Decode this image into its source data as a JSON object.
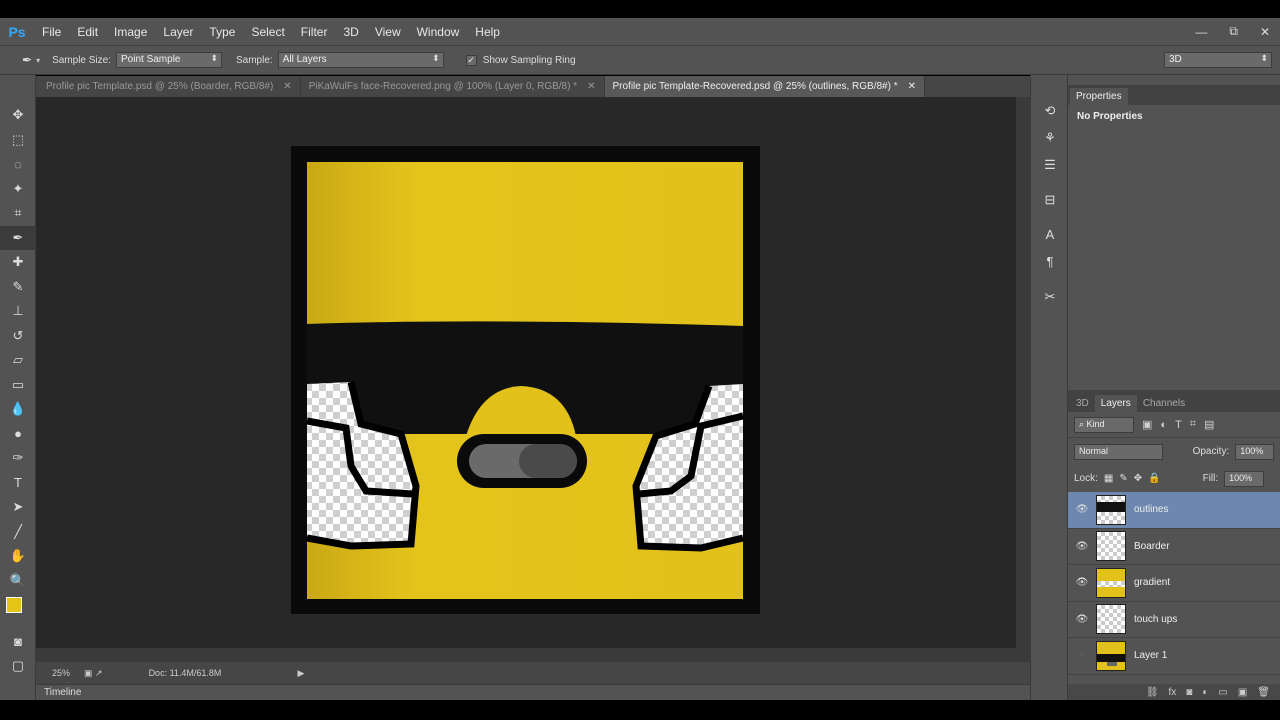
{
  "app": {
    "logo": "Ps"
  },
  "menu": [
    "File",
    "Edit",
    "Image",
    "Layer",
    "Type",
    "Select",
    "Filter",
    "3D",
    "View",
    "Window",
    "Help"
  ],
  "window_controls": {
    "minimize": "—",
    "restore": "⧉",
    "close": "✕"
  },
  "options": {
    "sample_size_label": "Sample Size:",
    "sample_size_value": "Point Sample",
    "sample_label": "Sample:",
    "sample_value": "All Layers",
    "show_ring_label": "Show Sampling Ring",
    "workspace_value": "3D"
  },
  "tabs": [
    {
      "title": "Profile pic Template.psd @ 25% (Boarder, RGB/8#)",
      "close": "✕"
    },
    {
      "title": "PiKaWulFs face-Recovered.png @ 100% (Layer 0, RGB/8) *",
      "close": "✕"
    },
    {
      "title": "Profile pic Template-Recovered.psd @ 25% (outlines, RGB/8#) *",
      "close": "✕"
    }
  ],
  "status": {
    "zoom": "25%",
    "doc_info": "Doc: 11.4M/61.8M"
  },
  "timeline_label": "Timeline",
  "properties": {
    "tab": "Properties",
    "empty_text": "No Properties"
  },
  "layers_panel": {
    "tabs": [
      "3D",
      "Layers",
      "Channels"
    ],
    "kind_filter": "Kind",
    "blend_mode": "Normal",
    "opacity_label": "Opacity:",
    "opacity_value": "100%",
    "lock_label": "Lock:",
    "fill_label": "Fill:",
    "fill_value": "100%",
    "layers": [
      {
        "name": "outlines",
        "visible": true,
        "selected": true
      },
      {
        "name": "Boarder",
        "visible": true,
        "selected": false
      },
      {
        "name": "gradient",
        "visible": true,
        "selected": false
      },
      {
        "name": "touch ups",
        "visible": true,
        "selected": false
      },
      {
        "name": "Layer 1",
        "visible": false,
        "selected": false
      }
    ]
  },
  "colors": {
    "foreground": "#e5c418",
    "background": "#ffffff",
    "canvas_yellow": "#e2c21a",
    "selected_layer": "#6d87ae"
  }
}
